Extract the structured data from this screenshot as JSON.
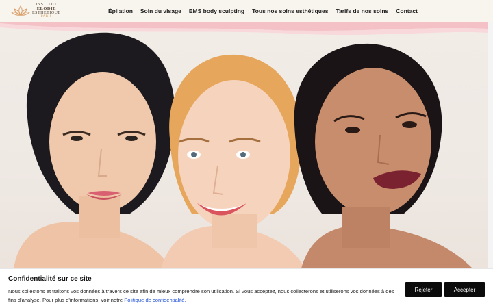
{
  "brand": {
    "line1": "INSTITUT",
    "line2": "ELODIE",
    "line3": "ESTHÉTIQUE",
    "line4": "PARIS",
    "accent": "#d9a06a"
  },
  "nav": {
    "items": [
      {
        "label": "Épilation"
      },
      {
        "label": "Soin du visage"
      },
      {
        "label": "EMS body sculpting"
      },
      {
        "label": "Tous nos soins esthétiques"
      },
      {
        "label": "Tarifs de nos soins"
      },
      {
        "label": "Contact"
      }
    ]
  },
  "hero": {
    "image": "three-women-smiling-portrait"
  },
  "cookie": {
    "title": "Confidentialité sur ce site",
    "text": "Nous collectons et traitons vos données à travers ce site afin de mieux comprendre son utilisation. Si vous acceptez, nous collecterons et utiliserons vos données à des fins d'analyse. Pour plus d'informations, voir notre ",
    "link": "Politique de confidentialité.",
    "reject": "Rejeter",
    "accept": "Accepter"
  }
}
